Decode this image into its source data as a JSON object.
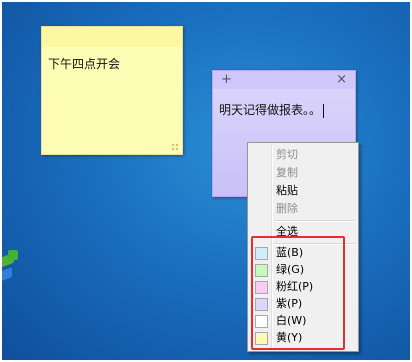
{
  "notes": {
    "yellow": {
      "text": "下午四点开会",
      "color": "#fefdb5"
    },
    "purple": {
      "text": "明天记得做报表。。",
      "color": "#d6cffb",
      "add_icon": "+",
      "close_icon": "×"
    }
  },
  "context_menu": {
    "edit_items": [
      {
        "label": "剪切",
        "enabled": false
      },
      {
        "label": "复制",
        "enabled": false
      },
      {
        "label": "粘贴",
        "enabled": true
      },
      {
        "label": "删除",
        "enabled": false
      }
    ],
    "select_all": "全选",
    "colors": [
      {
        "label": "蓝(B)",
        "swatch": "#d1ecfb"
      },
      {
        "label": "绿(G)",
        "swatch": "#c9f7c0"
      },
      {
        "label": "粉红(P)",
        "swatch": "#f7cdf3"
      },
      {
        "label": "紫(P)",
        "swatch": "#ddd6fb"
      },
      {
        "label": "白(W)",
        "swatch": "#ffffff"
      },
      {
        "label": "黄(Y)",
        "swatch": "#fdfcb3"
      }
    ]
  },
  "highlight_color": "#e0312e"
}
